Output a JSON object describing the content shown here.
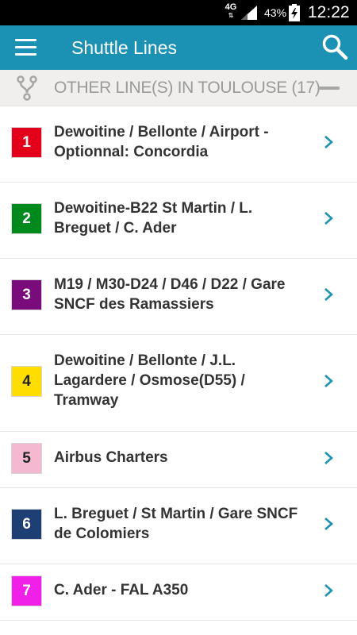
{
  "status_bar": {
    "network": "4G",
    "battery_percent": "43%",
    "time": "12:22",
    "icons": [
      "signal-icon",
      "battery-charging-icon"
    ]
  },
  "app_bar": {
    "title": "Shuttle Lines",
    "icons": [
      "menu-icon",
      "search-icon"
    ]
  },
  "section": {
    "title": "OTHER LINE(S) IN TOULOUSE (17)",
    "icons": [
      "fork-route-icon",
      "collapse-icon"
    ]
  },
  "lines": [
    {
      "number": "1",
      "name": "Dewoitine / Bellonte / Airport - Optionnal: Concordia",
      "color": "#e3001b",
      "text_color": "#ffffff"
    },
    {
      "number": "2",
      "name": "Dewoitine-B22 St Martin / L. Breguet / C. Ader",
      "color": "#008a1e",
      "text_color": "#ffffff"
    },
    {
      "number": "3",
      "name": "M19 / M30-D24 / D46 / D22 / Gare SNCF des Ramassiers",
      "color": "#7a0b7a",
      "text_color": "#ffffff"
    },
    {
      "number": "4",
      "name": "Dewoitine / Bellonte / J.L. Lagardere / Osmose(D55) / Tramway",
      "color": "#ffdd00",
      "text_color": "#222222"
    },
    {
      "number": "5",
      "name": "Airbus Charters",
      "color": "#f4b8d0",
      "text_color": "#222222"
    },
    {
      "number": "6",
      "name": "L. Breguet / St Martin / Gare SNCF de Colomiers",
      "color": "#1e3f73",
      "text_color": "#ffffff"
    },
    {
      "number": "7",
      "name": "C. Ader - FAL A350",
      "color": "#f020e8",
      "text_color": "#ffffff"
    }
  ],
  "colors": {
    "app_bar": "#1b91b4",
    "chevron": "#1b91b4",
    "section_bg": "#f0efed"
  }
}
